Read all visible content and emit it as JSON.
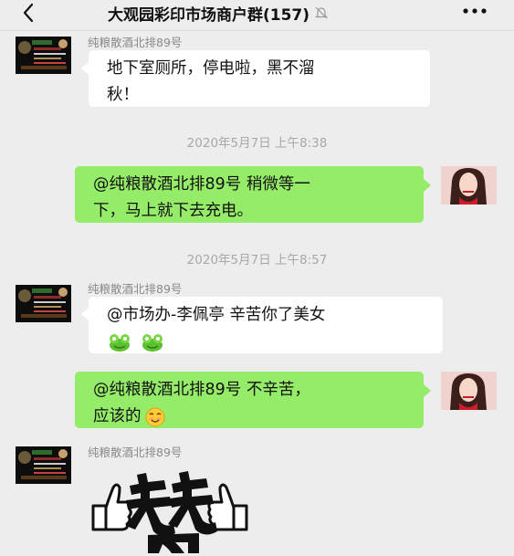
{
  "header": {
    "title": "大观园彩印市场商户群(157)",
    "back_icon": "chevron-left-icon",
    "mute_icon": "bell-muted-icon",
    "more_icon": "more-dots-icon"
  },
  "messages": [
    {
      "sender": "纯粮散酒北排89号",
      "line1": "地下室厕所，停电啦，黑不溜",
      "line2": "秋！"
    },
    {
      "time": "2020年5月7日 上午8:38"
    },
    {
      "line1": "@纯粮散酒北排89号 稍微等一",
      "line2": "下，马上就下去充电。"
    },
    {
      "time": "2020年5月7日 上午8:57"
    },
    {
      "sender": "纯粮散酒北排89号",
      "line1": "@市场办-李佩亭 辛苦你了美女"
    },
    {
      "line1": "@纯粮散酒北排89号 不辛苦，",
      "line2": "应该的"
    },
    {
      "sender": "纯粮散酒北排89号",
      "sticker_icon": "thumbs-up-sticker-icon"
    }
  ],
  "colors": {
    "background": "#ededed",
    "self_bubble": "#95ec69",
    "other_bubble": "#ffffff"
  }
}
